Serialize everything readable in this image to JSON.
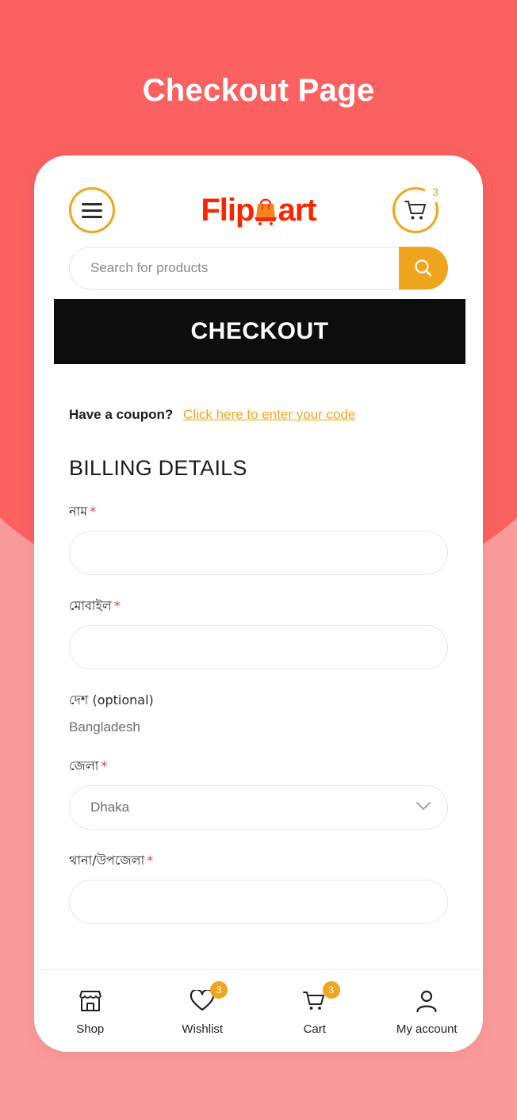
{
  "page": {
    "title": "Checkout Page",
    "bg_color_top": "#FB6161",
    "bg_color_bottom": "#FB9A9A",
    "accent_color": "#F0A51E",
    "logo_color": "#FA2600"
  },
  "header": {
    "menu_icon": "hamburger-menu-icon",
    "logo": {
      "pre": "Flip",
      "post": "art",
      "icon": "shopping-bag-cart-icon"
    },
    "cart_icon": "shopping-cart-icon",
    "cart_badge": "3"
  },
  "search": {
    "placeholder": "Search for products",
    "value": "",
    "button_icon": "search-icon"
  },
  "banner": {
    "label": "CHECKOUT"
  },
  "coupon": {
    "prompt": "Have a coupon?",
    "link": "Click here to enter your code"
  },
  "billing": {
    "heading": "BILLING DETAILS",
    "fields": [
      {
        "label": "নাম",
        "required": "*",
        "type": "text",
        "value": "",
        "placeholder": ""
      },
      {
        "label": "মোবাইল",
        "required": "*",
        "type": "text",
        "value": "",
        "placeholder": ""
      },
      {
        "label": "দেশ (optional)",
        "required": "",
        "type": "static",
        "value": "Bangladesh"
      },
      {
        "label": "জেলা",
        "required": "*",
        "type": "select",
        "value": "Dhaka"
      },
      {
        "label": "থানা/উপজেলা",
        "required": "*",
        "type": "text",
        "value": "",
        "placeholder": ""
      }
    ]
  },
  "bottom_nav": {
    "items": [
      {
        "label": "Shop",
        "icon": "store-icon",
        "badge": ""
      },
      {
        "label": "Wishlist",
        "icon": "heart-icon",
        "badge": "3"
      },
      {
        "label": "Cart",
        "icon": "cart-icon",
        "badge": "3"
      },
      {
        "label": "My account",
        "icon": "user-icon",
        "badge": ""
      }
    ]
  }
}
